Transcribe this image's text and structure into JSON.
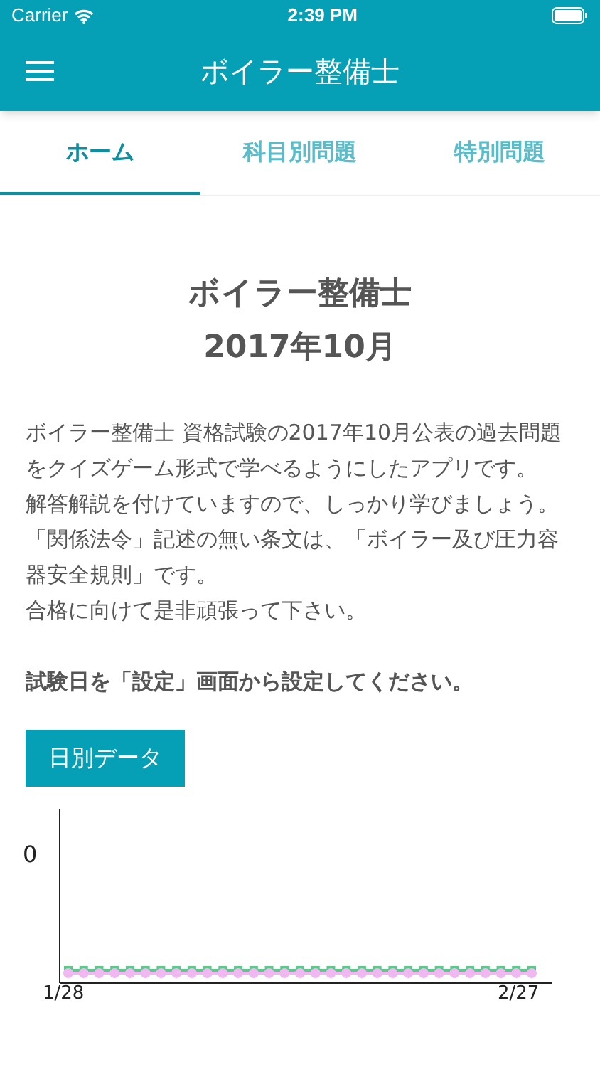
{
  "status_bar": {
    "carrier": "Carrier",
    "time": "2:39 PM"
  },
  "header": {
    "title": "ボイラー整備士"
  },
  "tabs": [
    {
      "label": "ホーム",
      "selected": true
    },
    {
      "label": "科目別問題",
      "selected": false
    },
    {
      "label": "特別問題",
      "selected": false
    }
  ],
  "home": {
    "title": "ボイラー整備士",
    "subtitle": "2017年10月",
    "paragraphs": [
      "ボイラー整備士 資格試験の2017年10月公表の過去問題をクイズゲーム形式で学べるようにしたアプリです。",
      "解答解説を付けていますので、しっかり学びましょう。",
      "「関係法令」記述の無い条文は、「ボイラー及び圧力容器安全規則」です。",
      "合格に向けて是非頑張って下さい。"
    ],
    "notice": "試験日を「設定」画面から設定してください。",
    "button": "日別データ",
    "chart": {
      "y_label": "0",
      "x_start": "1/28",
      "x_end": "2/27"
    }
  }
}
